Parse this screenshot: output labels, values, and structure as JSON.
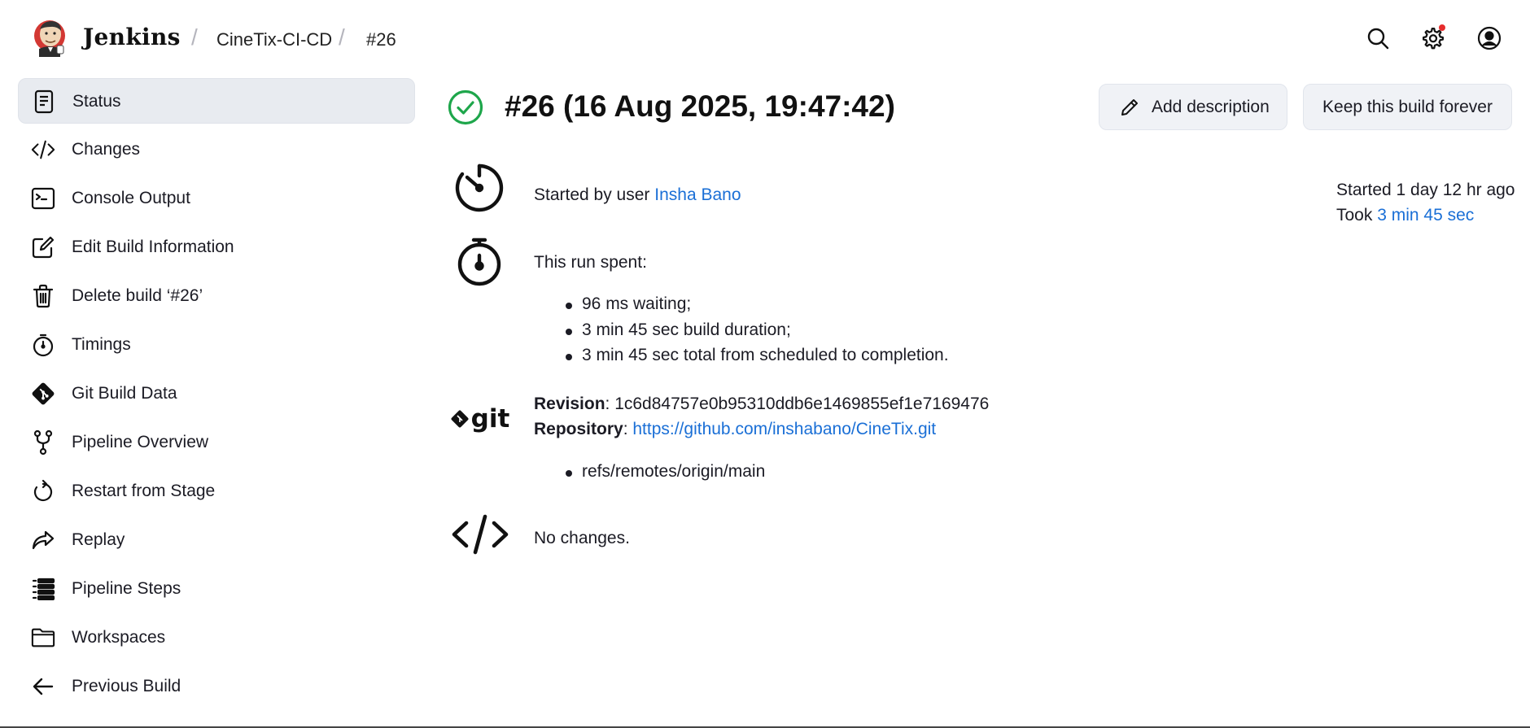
{
  "header": {
    "brand": "Jenkins",
    "breadcrumbs": [
      "CineTix-CI-CD",
      "#26"
    ],
    "separator": "/",
    "icons": [
      "search-icon",
      "gear-icon",
      "user-icon"
    ],
    "notification_color": "#e62c2c"
  },
  "sidebar": {
    "items": [
      {
        "label": "Status",
        "icon": "document-icon",
        "active": true
      },
      {
        "label": "Changes",
        "icon": "code-icon"
      },
      {
        "label": "Console Output",
        "icon": "terminal-icon"
      },
      {
        "label": "Edit Build Information",
        "icon": "edit-icon"
      },
      {
        "label": "Delete build ‘#26’",
        "icon": "trash-icon"
      },
      {
        "label": "Timings",
        "icon": "stopwatch-icon"
      },
      {
        "label": "Git Build Data",
        "icon": "git-icon"
      },
      {
        "label": "Pipeline Overview",
        "icon": "branch-icon"
      },
      {
        "label": "Restart from Stage",
        "icon": "restart-icon"
      },
      {
        "label": "Replay",
        "icon": "replay-icon"
      },
      {
        "label": "Pipeline Steps",
        "icon": "list-icon"
      },
      {
        "label": "Workspaces",
        "icon": "folder-icon"
      },
      {
        "label": "Previous Build",
        "icon": "arrow-left-icon"
      }
    ]
  },
  "main": {
    "title": "#26 (16 Aug 2025, 19:47:42)",
    "status_color": "#1ea64b",
    "add_description": "Add description",
    "keep_forever": "Keep this build forever",
    "started_by_prefix": "Started by user ",
    "started_by_user": "Insha Bano",
    "started_ago": "Started 1 day 12 hr ago",
    "took_prefix": "Took ",
    "took_value": "3 min 45 sec",
    "run_spent_label": "This run spent:",
    "run_spent_items": [
      "96 ms waiting;",
      "3 min 45 sec build duration;",
      "3 min 45 sec total from scheduled to completion."
    ],
    "git_logo_text": "git",
    "revision_label": "Revision",
    "revision_value": ": 1c6d84757e0b95310ddb6e1469855ef1e7169476",
    "repository_label": "Repository",
    "repository_sep": ": ",
    "repository_url": "https://github.com/inshabano/CineTix.git",
    "refs": [
      "refs/remotes/origin/main"
    ],
    "no_changes": "No changes."
  }
}
